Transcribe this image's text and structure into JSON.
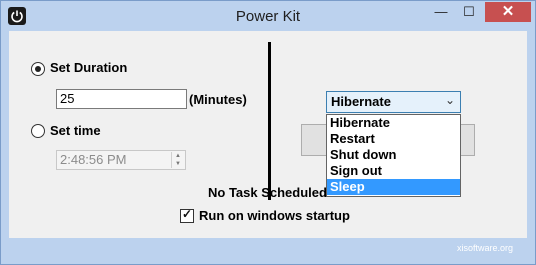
{
  "window": {
    "title": "Power Kit",
    "minimize_glyph": "—",
    "maximize_glyph": "☐",
    "close_glyph": "✕",
    "app_icon": "power-icon"
  },
  "duration": {
    "radio_label": "Set Duration",
    "value": "25",
    "unit": "(Minutes)",
    "selected": true
  },
  "time": {
    "radio_label": "Set time",
    "value": "2:48:56 PM",
    "selected": false
  },
  "action": {
    "selected": "Hibernate",
    "options": [
      "Hibernate",
      "Restart",
      "Shut down",
      "Sign out",
      "Sleep"
    ],
    "highlighted": "Sleep"
  },
  "status": "No Task Scheduled",
  "startup": {
    "label": "Run on windows startup",
    "checked": true
  },
  "footer": "xisoftware.org"
}
